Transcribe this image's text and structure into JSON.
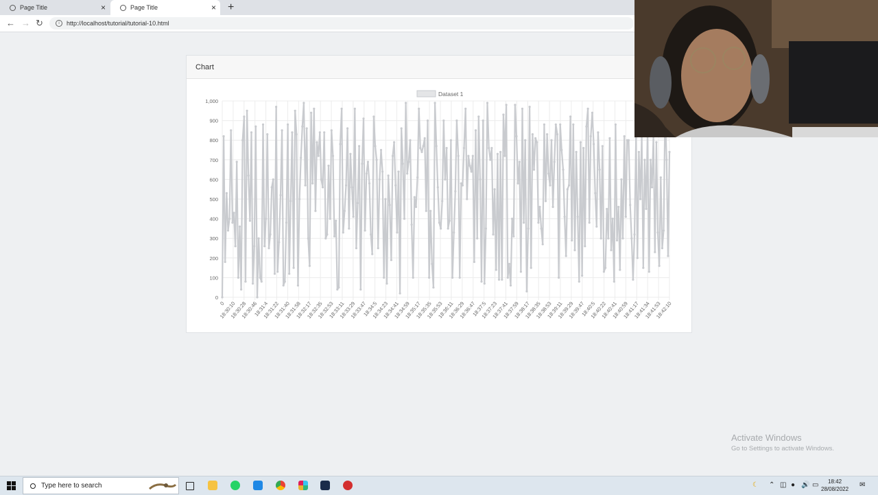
{
  "browser": {
    "tabs": [
      {
        "title": "Page Title",
        "active": false
      },
      {
        "title": "Page Title",
        "active": true
      }
    ],
    "new_tab_glyph": "+",
    "url": "http://localhost/tutorial/tutorial-10.html",
    "icons": {
      "back": "back-arrow-icon",
      "forward": "forward-arrow-icon",
      "reload": "reload-icon",
      "info": "site-info-icon"
    }
  },
  "card": {
    "header": "Chart"
  },
  "chart_data": {
    "type": "line",
    "legend": [
      "Dataset 1"
    ],
    "legend_position": "top",
    "series": [
      {
        "name": "Dataset 1",
        "color": "#c9cbcf",
        "values": [
          0,
          820,
          180,
          530,
          340,
          400,
          850,
          380,
          430,
          260,
          690,
          100,
          360,
          40,
          800,
          920,
          80,
          950,
          620,
          390,
          840,
          70,
          260,
          870,
          0,
          300,
          100,
          80,
          880,
          260,
          400,
          830,
          250,
          320,
          560,
          600,
          120,
          970,
          130,
          280,
          520,
          850,
          60,
          80,
          380,
          880,
          120,
          490,
          840,
          150,
          950,
          830,
          60,
          500,
          710,
          870,
          990,
          570,
          860,
          300,
          160,
          940,
          580,
          960,
          440,
          790,
          720,
          840,
          600,
          560,
          840,
          300,
          320,
          670,
          400,
          850,
          720,
          310,
          390,
          40,
          50,
          780,
          960,
          330,
          440,
          570,
          860,
          350,
          730,
          560,
          410,
          960,
          250,
          480,
          770,
          40,
          680,
          910,
          340,
          630,
          690,
          580,
          320,
          220,
          920,
          770,
          700,
          250,
          600,
          750,
          640,
          100,
          500,
          70,
          620,
          470,
          190,
          720,
          790,
          570,
          330,
          640,
          20,
          860,
          680,
          400,
          990,
          630,
          690,
          800,
          370,
          100,
          510,
          460,
          610,
          960,
          760,
          740,
          770,
          810,
          440,
          900,
          100,
          440,
          170,
          50,
          990,
          770,
          560,
          380,
          350,
          490,
          900,
          600,
          760,
          350,
          390,
          800,
          100,
          330,
          540,
          900,
          720,
          100,
          580,
          570,
          760,
          960,
          500,
          720,
          670,
          640,
          720,
          180,
          850,
          300,
          920,
          600,
          80,
          900,
          70,
          350,
          990,
          760,
          700,
          760,
          320,
          550,
          140,
          730,
          90,
          740,
          90,
          930,
          720,
          980,
          100,
          170,
          60,
          400,
          310,
          980,
          820,
          580,
          690,
          130,
          960,
          380,
          800,
          30,
          350,
          970,
          150,
          830,
          650,
          810,
          790,
          380,
          460,
          350,
          270,
          880,
          490,
          830,
          630,
          570,
          800,
          460,
          690,
          880,
          830,
          100,
          880,
          750,
          650,
          410,
          210,
          550,
          570,
          920,
          290,
          880,
          240,
          740,
          410,
          80,
          790,
          110,
          760,
          260,
          870,
          960,
          380,
          820,
          940,
          780,
          530,
          360,
          840,
          650,
          300,
          770,
          130,
          150,
          450,
          300,
          810,
          240,
          400,
          80,
          880,
          290,
          460,
          140,
          600,
          300,
          820,
          410,
          800,
          800,
          470,
          300,
          90,
          320,
          810,
          200,
          740,
          500,
          820,
          150,
          700,
          450,
          860,
          130,
          700,
          560,
          820,
          230,
          790,
          330,
          160,
          610,
          250,
          340,
          950,
          700,
          210,
          740
        ]
      }
    ],
    "x_tick_labels": [
      "0",
      "18:30:10",
      "18:30:28",
      "18:30:46",
      "18:31:4",
      "18:31:22",
      "18:31:40",
      "18:31:58",
      "18:32:17",
      "18:32:35",
      "18:32:53",
      "18:33:11",
      "18:33:29",
      "18:33:47",
      "18:34:5",
      "18:34:23",
      "18:34:41",
      "18:34:59",
      "18:35:17",
      "18:35:35",
      "18:35:53",
      "18:36:11",
      "18:36:29",
      "18:36:47",
      "18:37:5",
      "18:37:23",
      "18:37:41",
      "18:37:59",
      "18:38:17",
      "18:38:35",
      "18:38:53",
      "18:39:11",
      "18:39:29",
      "18:39:47",
      "18:40:5",
      "18:40:22",
      "18:40:41",
      "18:40:59",
      "18:41:17",
      "18:41:34",
      "18:41:53",
      "18:42:10"
    ],
    "y_ticks": [
      "1,000",
      "900",
      "800",
      "700",
      "600",
      "500",
      "400",
      "300",
      "200",
      "100",
      "0"
    ],
    "ylim": [
      0,
      1000
    ],
    "grid": true
  },
  "watermark": {
    "title": "Activate Windows",
    "subtitle": "Go to Settings to activate Windows."
  },
  "taskbar": {
    "search_placeholder": "Type here to search",
    "time": "18:42",
    "date": "28/08/2022",
    "icons": [
      "task-view-icon",
      "file-explorer-icon",
      "whatsapp-icon",
      "vscode-icon",
      "chrome-icon",
      "slack-icon",
      "app-icon",
      "app-red-icon"
    ],
    "colors": {
      "whatsapp": "#25d366",
      "vscode": "#1e88e5",
      "explorer": "#f6c342"
    }
  }
}
